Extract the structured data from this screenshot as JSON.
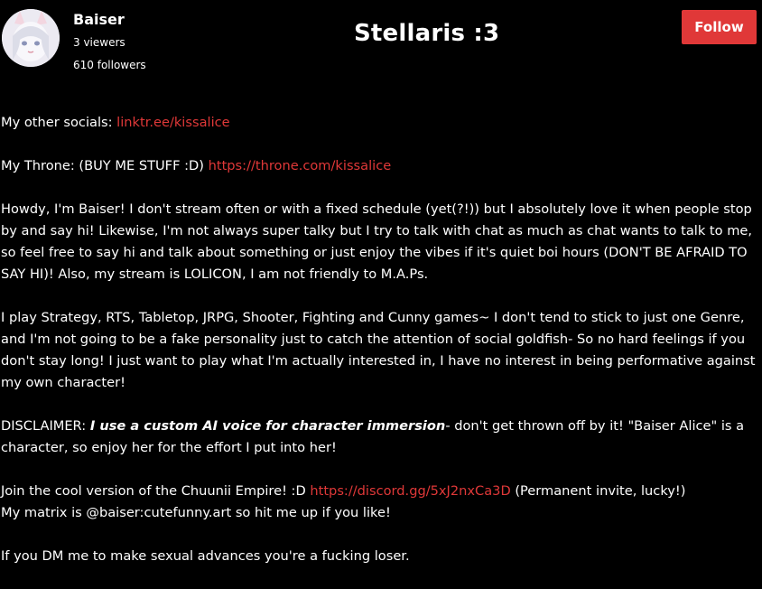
{
  "header": {
    "streamer_name": "Baiser",
    "viewers": "3 viewers",
    "followers": "610 followers",
    "stream_title": "Stellaris :3",
    "follow_label": "Follow"
  },
  "colors": {
    "accent": "#e03838",
    "background": "#000000",
    "text": "#ffffff"
  },
  "bio": {
    "socials_prefix": "My other socials: ",
    "socials_link": "linktr.ee/kissalice",
    "throne_prefix": "My Throne: (BUY ME STUFF :D) ",
    "throne_link": "https://throne.com/kissalice",
    "howdy": "Howdy, I'm Baiser! I don't stream often or with a fixed schedule (yet(?!)) but I absolutely love it when people stop by and say hi! Likewise, I'm not always super talky but I try to talk with chat as much as chat wants to talk to me, so feel free to say hi and talk about something or just enjoy the vibes if it's quiet boi hours (DON'T BE AFRAID TO SAY HI)! Also, my stream is LOLICON, I am not friendly to M.A.Ps.",
    "games": "I play Strategy, RTS, Tabletop, JRPG, Shooter, Fighting and Cunny games~ I don't tend to stick to just one Genre, and I'm not going to be a fake personality just to catch the attention of social goldfish- So no hard feelings if you don't stay long! I just want to play what I'm actually interested in, I have no interest in being performative against my own character!",
    "disclaimer_prefix": "DISCLAIMER: ",
    "disclaimer_emphasis": "I use a custom AI voice for character immersion",
    "disclaimer_suffix": "- don't get thrown off by it! \"Baiser Alice\" is a character, so enjoy her for the effort I put into her!",
    "join_prefix": "Join the cool version of the Chuunii Empire! :D ",
    "discord_link": "https://discord.gg/5xJ2nxCa3D",
    "join_suffix": " (Permanent invite, lucky!)",
    "matrix": "My matrix is @baiser:cutefunny.art so hit me up if you like!",
    "dm_warning": "If you DM me to make sexual advances you're a fucking loser."
  }
}
